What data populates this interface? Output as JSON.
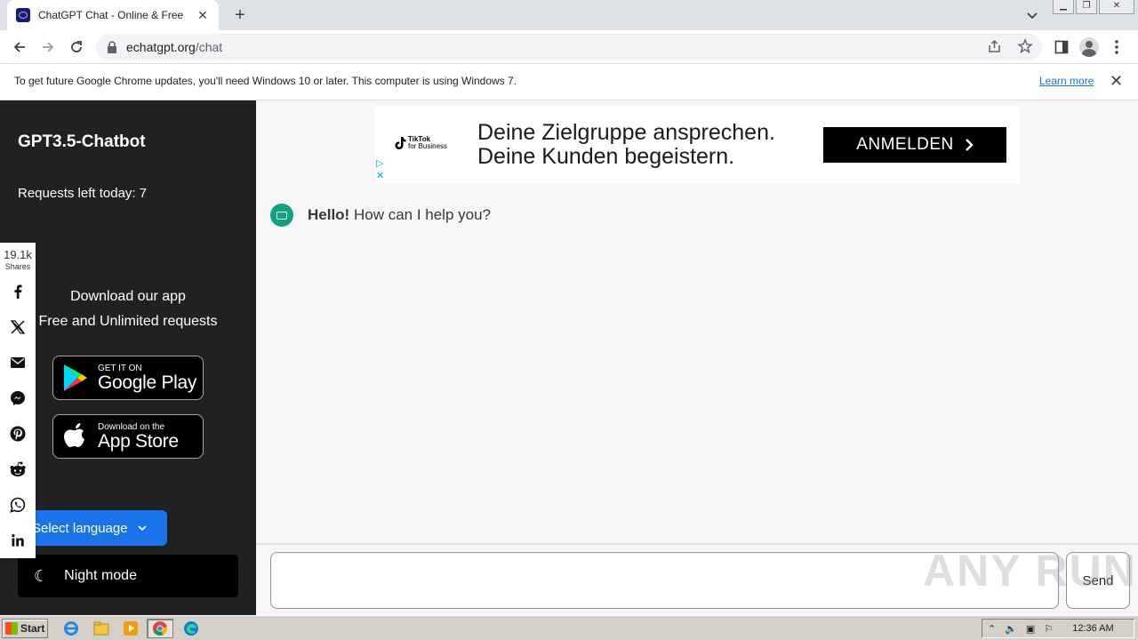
{
  "browser": {
    "tab_title": "ChatGPT Chat - Online & Free",
    "url_host": "echatgpt.org",
    "url_path": "/chat",
    "infobar_message": "To get future Google Chrome updates, you'll need Windows 10 or later. This computer is using Windows 7.",
    "infobar_link": "Learn more"
  },
  "sidebar": {
    "brand": "GPT3.5-Chatbot",
    "requests": "Requests left today: 7",
    "download_title": "Download our app",
    "download_sub": "Free and Unlimited requests",
    "google_small": "GET IT ON",
    "google_big": "Google Play",
    "apple_small": "Download on the",
    "apple_big": "App Store",
    "language_label": "Select language",
    "night_label": "Night mode"
  },
  "share": {
    "count": "19.1k",
    "label": "Shares",
    "networks": [
      "facebook-icon",
      "x-icon",
      "email-icon",
      "messenger-icon",
      "pinterest-icon",
      "reddit-icon",
      "whatsapp-icon",
      "linkedin-icon"
    ]
  },
  "ad": {
    "logo_line1": "TikTok",
    "logo_line2": "for Business",
    "line1": "Deine Zielgruppe ansprechen.",
    "line2": "Deine Kunden begeistern.",
    "cta": "ANMELDEN"
  },
  "chat": {
    "greeting_bold": "Hello!",
    "greeting_rest": " How can I help you?",
    "send_label": "Send"
  },
  "watermark": "ANY RUN",
  "taskbar": {
    "start_label": "Start",
    "clock": "12:36 AM"
  },
  "colors": {
    "sidebar_bg": "#202123",
    "accent_blue": "#1a73e8",
    "bot_green": "#10a37f"
  }
}
